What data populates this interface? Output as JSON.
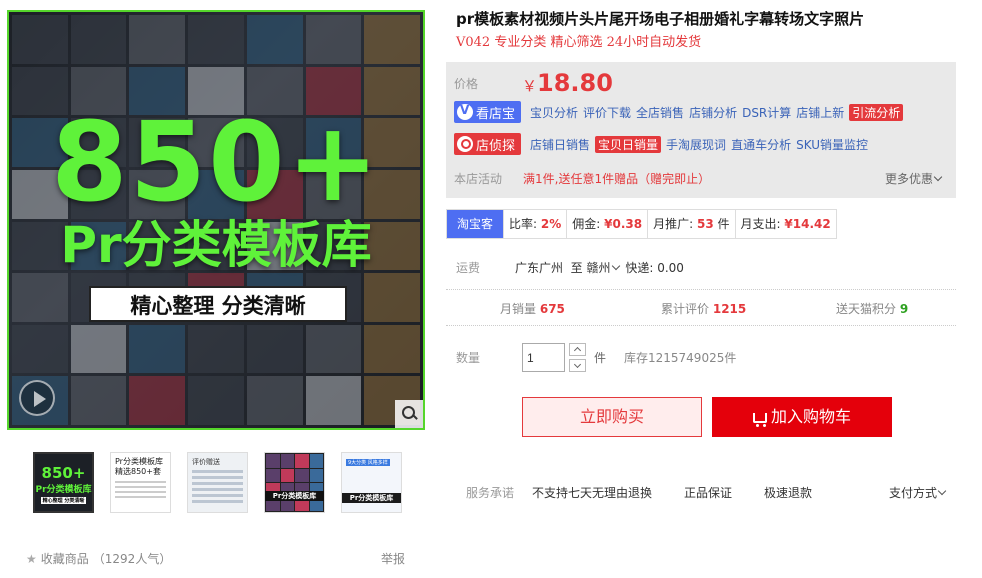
{
  "gallery": {
    "hero_count": "850+",
    "hero_title": "Pr分类模板库",
    "hero_slogan": "精心整理 分类清晰",
    "thumbnails": [
      {
        "line1": "850+",
        "line2": "Pr分类模板库",
        "line3": "精心整理 分类清晰"
      },
      {
        "line1": "Pr分类模板库",
        "line2": "精选850+套"
      },
      {
        "line1": "评价赠送"
      },
      {
        "line1": "Pr分类模板库"
      },
      {
        "line1": "9大分类 风格多样",
        "line2": "Pr分类模板库"
      }
    ]
  },
  "footer": {
    "favorite_label": "收藏商品",
    "popularity": "（1292人气）",
    "report": "举报"
  },
  "product": {
    "title": "pr模板素材视频片头片尾开场电子相册婚礼字幕转场文字照片",
    "subtitle": "V042 专业分类 精心筛选 24小时自动发货",
    "price_label": "价格",
    "currency": "￥",
    "price": "18.80",
    "toolbar1": {
      "brand": "看店宝",
      "links": [
        "宝贝分析",
        "评价下载",
        "全店销售",
        "店铺分析",
        "DSR计算",
        "店铺上新"
      ],
      "highlight": "引流分析"
    },
    "toolbar2": {
      "brand": "店侦探",
      "link1": "店铺日销售",
      "highlight": "宝贝日销量",
      "links": [
        "手淘展现词",
        "直通车分析",
        "SKU销量监控"
      ]
    },
    "promo_label": "本店活动",
    "promo_text": "满1件,送任意1件赠品（赠完即止）",
    "more_offers": "更多优惠"
  },
  "taobaoke": {
    "badge": "淘宝客",
    "ratio_label": "比率:",
    "ratio": "2%",
    "commission_label": "佣金:",
    "commission": "¥0.38",
    "monthly_promo_label": "月推广:",
    "monthly_promo": "53",
    "monthly_promo_unit": "件",
    "monthly_spend_label": "月支出:",
    "monthly_spend": "¥14.42"
  },
  "shipping": {
    "label": "运费",
    "from": "广东广州",
    "to_word": "至",
    "to": "赣州",
    "fee_label": "快递:",
    "fee": "0.00"
  },
  "metrics": {
    "monthly_sales_label": "月销量",
    "monthly_sales": "675",
    "reviews_label": "累计评价",
    "reviews": "1215",
    "points_label": "送天猫积分",
    "points": "9"
  },
  "quantity": {
    "label": "数量",
    "value": "1",
    "unit": "件",
    "stock": "库存1215749025件"
  },
  "actions": {
    "buy_now": "立即购买",
    "add_to_cart": "加入购物车"
  },
  "service": {
    "label": "服务承诺",
    "items": [
      "不支持七天无理由退换",
      "正品保证",
      "极速退款"
    ],
    "payment": "支付方式"
  },
  "colors": {
    "accent_red": "#e4393c",
    "brand_blue": "#4e6ef2",
    "hero_green": "#5ff23a",
    "points_green": "#2ea121"
  }
}
